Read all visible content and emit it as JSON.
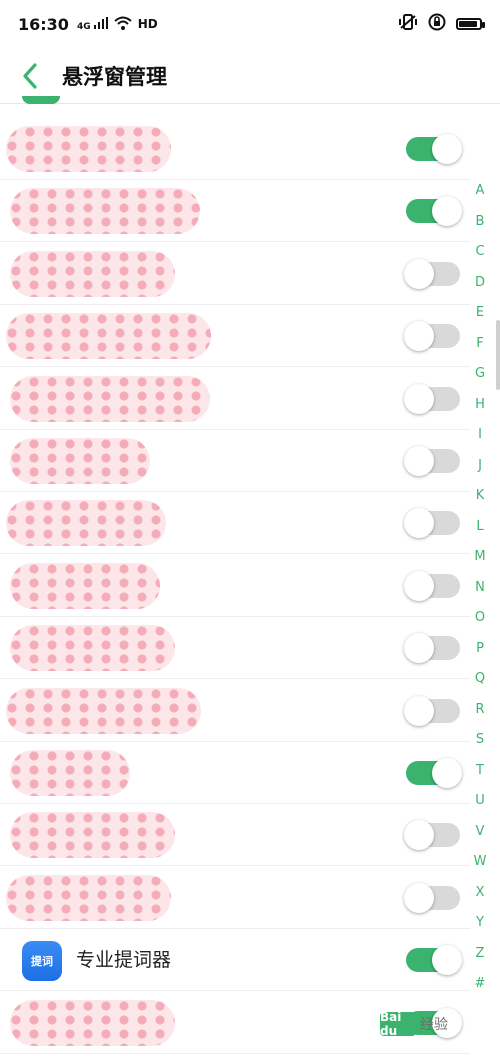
{
  "status_bar": {
    "time": "16:30",
    "network": "4G",
    "wifi_label": "HD",
    "icons": [
      "signal-icon",
      "wifi-icon",
      "vibrate-icon",
      "lock-rotation-icon",
      "battery-icon"
    ]
  },
  "header": {
    "title": "悬浮窗管理",
    "back_icon": "chevron-left-icon"
  },
  "colors": {
    "accent": "#3bb36f",
    "toggle_off": "#d9d9d9"
  },
  "apps": [
    {
      "name": "",
      "redacted": true,
      "enabled": true
    },
    {
      "name": "",
      "redacted": true,
      "enabled": true
    },
    {
      "name": "",
      "redacted": true,
      "enabled": false
    },
    {
      "name": "",
      "redacted": true,
      "enabled": false
    },
    {
      "name": "",
      "redacted": true,
      "enabled": false
    },
    {
      "name": "",
      "redacted": true,
      "enabled": false
    },
    {
      "name": "",
      "redacted": true,
      "enabled": false
    },
    {
      "name": "",
      "redacted": true,
      "enabled": false
    },
    {
      "name": "",
      "redacted": true,
      "enabled": false
    },
    {
      "name": "",
      "redacted": true,
      "enabled": false
    },
    {
      "name": "",
      "redacted": true,
      "enabled": true
    },
    {
      "name": "",
      "redacted": true,
      "enabled": false
    },
    {
      "name": "",
      "redacted": true,
      "enabled": false
    },
    {
      "name": "专业提词器",
      "icon_text": "提词",
      "redacted": false,
      "enabled": true
    },
    {
      "name": "",
      "redacted": true,
      "enabled": true
    }
  ],
  "index_letters": [
    "A",
    "B",
    "C",
    "D",
    "E",
    "F",
    "G",
    "H",
    "I",
    "J",
    "K",
    "L",
    "M",
    "N",
    "O",
    "P",
    "Q",
    "R",
    "S",
    "T",
    "U",
    "V",
    "W",
    "X",
    "Y",
    "Z",
    "#"
  ],
  "watermark": {
    "logo": "Bai du",
    "text": "经验"
  }
}
